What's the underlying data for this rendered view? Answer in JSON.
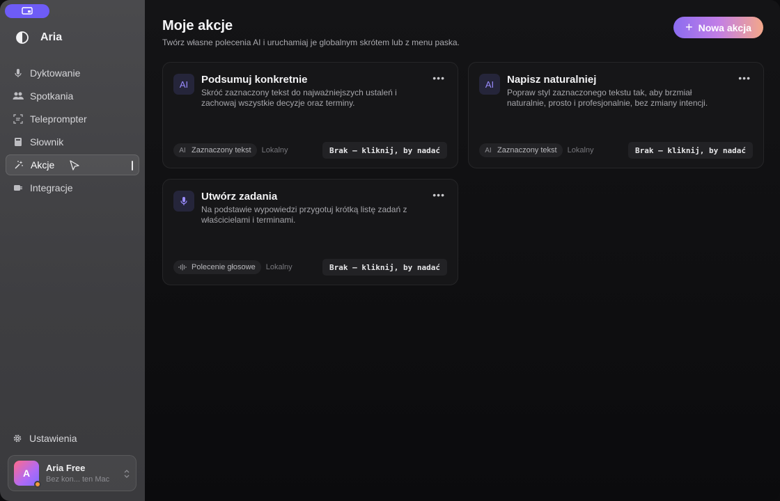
{
  "app": {
    "name": "Aria"
  },
  "sidebar": {
    "items": [
      {
        "label": "Dyktowanie",
        "icon": "microphone-icon"
      },
      {
        "label": "Spotkania",
        "icon": "users-icon"
      },
      {
        "label": "Teleprompter",
        "icon": "teleprompter-icon"
      },
      {
        "label": "Słownik",
        "icon": "book-icon"
      },
      {
        "label": "Akcje",
        "icon": "sparkle-wand-icon",
        "active": true
      },
      {
        "label": "Integracje",
        "icon": "plug-icon"
      }
    ],
    "settings_label": "Ustawienia",
    "account": {
      "initial": "A",
      "name": "Aria Free",
      "subtitle": "Bez kon... ten Mac"
    }
  },
  "main": {
    "title": "Moje akcje",
    "subtitle": "Twórz własne polecenia AI i uruchamiaj je globalnym skrótem lub z menu paska.",
    "new_action_label": "Nowa akcja",
    "cards": [
      {
        "title": "Podsumuj konkretnie",
        "description": "Skróć zaznaczony tekst do najważniejszych ustaleń i zachowaj wszystkie decyzje oraz terminy.",
        "trigger": "Zaznaczony tekst",
        "scope": "Lokalny",
        "shortcut": "Brak – kliknij, by nadać",
        "icon": "text-cursor-icon"
      },
      {
        "title": "Napisz naturalniej",
        "description": "Popraw styl zaznaczonego tekstu tak, aby brzmiał naturalnie, prosto i profesjonalnie, bez zmiany intencji.",
        "trigger": "Zaznaczony tekst",
        "scope": "Lokalny",
        "shortcut": "Brak – kliknij, by nadać",
        "icon": "text-cursor-icon"
      },
      {
        "title": "Utwórz zadania",
        "description": "Na podstawie wypowiedzi przygotuj krótką listę zadań z właścicielami i terminami.",
        "trigger": "Polecenie głosowe",
        "scope": "Lokalny",
        "shortcut": "Brak – kliknij, by nadać",
        "icon": "microphone-icon"
      }
    ]
  },
  "colors": {
    "accent": "#6e5cf6",
    "sidebar_bg": "#444447",
    "card_bg": "#161618",
    "gradient_start": "#8b6cf0",
    "gradient_end": "#f3a789"
  }
}
